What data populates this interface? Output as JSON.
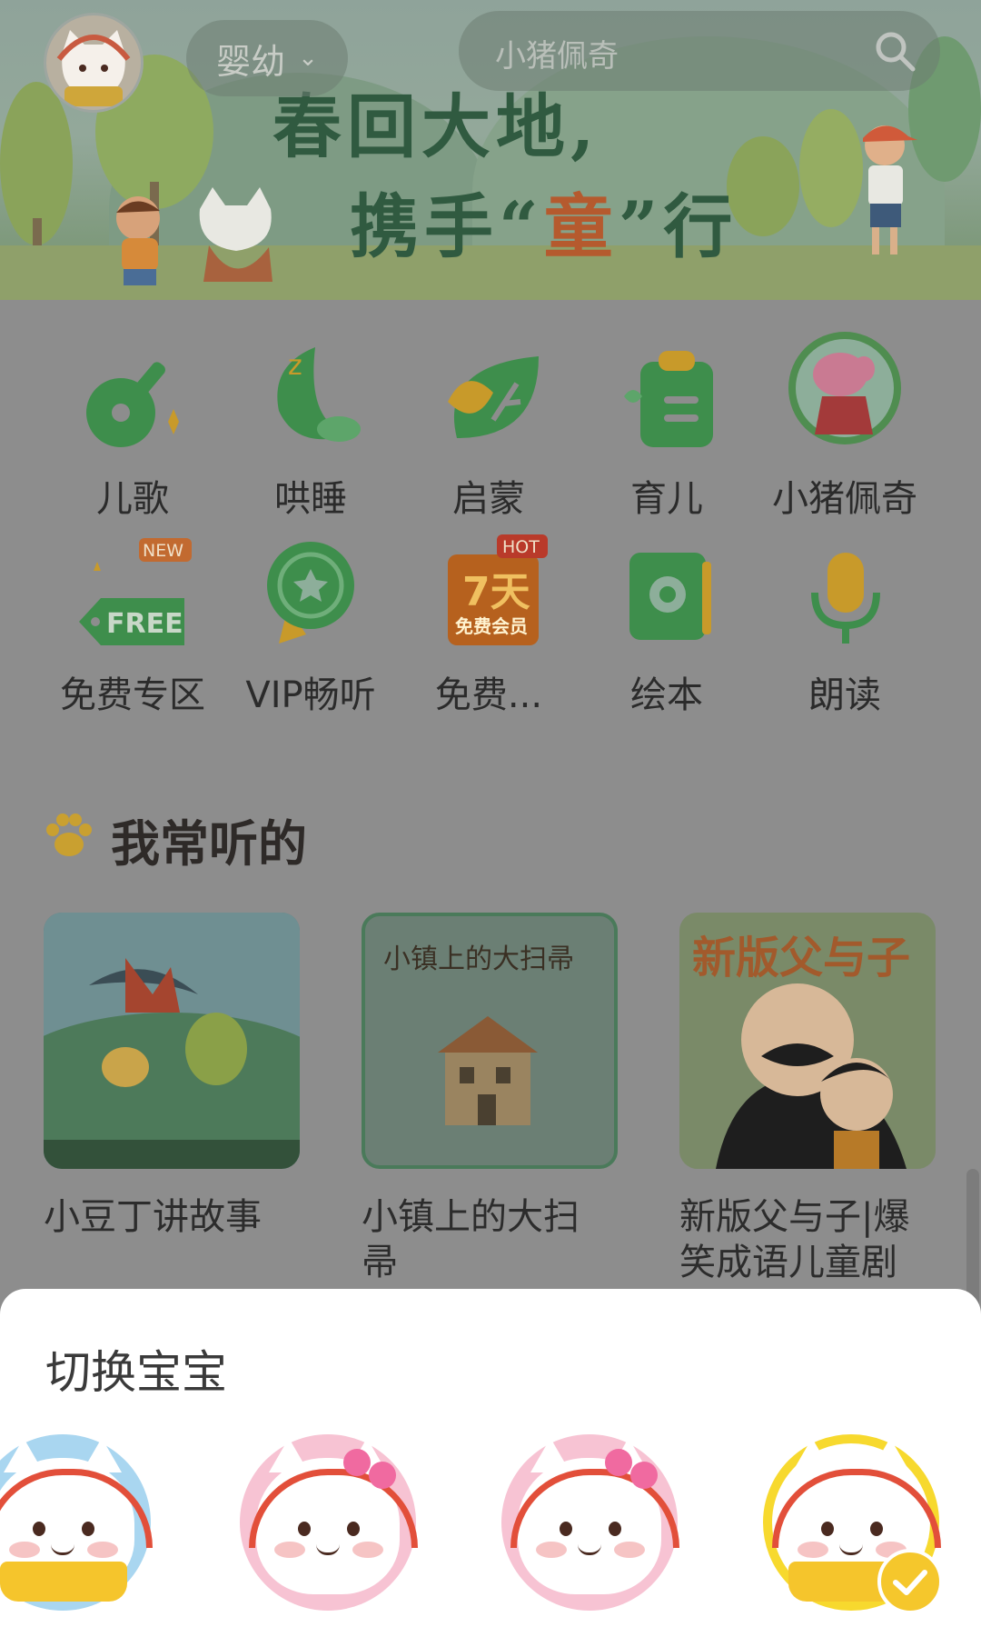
{
  "header": {
    "age_filter": "婴幼",
    "search_placeholder": "小猪佩奇"
  },
  "banner": {
    "line1": "春回大地,",
    "line2_pre": "携手“",
    "line2_highlight": "童",
    "line2_post": "”行"
  },
  "categories": [
    {
      "label": "儿歌",
      "icon": "guitar-icon",
      "color": "#3a8a47"
    },
    {
      "label": "哄睡",
      "icon": "moon-icon",
      "color": "#3a8a47"
    },
    {
      "label": "启蒙",
      "icon": "leaf-icon",
      "color": "#3a8a47"
    },
    {
      "label": "育儿",
      "icon": "clipboard-icon",
      "color": "#3a8a47"
    },
    {
      "label": "小猪佩奇",
      "icon": "peppa-pig-icon",
      "color": "#b9607a"
    },
    {
      "label": "免费专区",
      "icon": "free-tag-icon",
      "badge": "NEW"
    },
    {
      "label": "VIP畅听",
      "icon": "vip-medal-icon"
    },
    {
      "label": "免费...",
      "icon": "seven-day-member-icon",
      "badge": "HOT",
      "icon_text_top": "7天",
      "icon_text_bottom": "免费会员"
    },
    {
      "label": "绘本",
      "icon": "picture-book-icon"
    },
    {
      "label": "朗读",
      "icon": "microphone-icon"
    }
  ],
  "section": {
    "title": "我常听的",
    "items": [
      {
        "title": "小豆丁讲故事"
      },
      {
        "title": "小镇上的大扫帚",
        "cover_text": "小镇上的大扫帚"
      },
      {
        "title": "新版父与子|爆笑成语儿童剧",
        "cover_text": "新版父与子"
      }
    ]
  },
  "sheet": {
    "title": "切换宝宝",
    "babies": [
      {
        "style": "blue-reading",
        "selected": false
      },
      {
        "style": "pink-bow",
        "selected": false
      },
      {
        "style": "pink-bow",
        "selected": false
      },
      {
        "style": "yellow-reading",
        "selected": true
      }
    ]
  },
  "colors": {
    "overlay": "#8d8d8d",
    "accent_yellow": "#f5c72c",
    "sheet_bg": "#ffffff"
  }
}
